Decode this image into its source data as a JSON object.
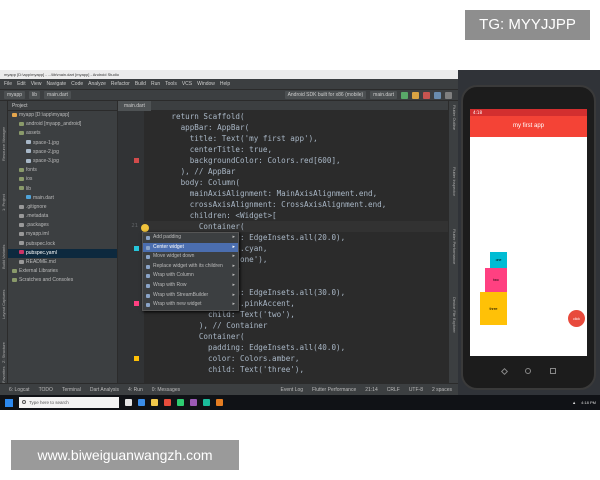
{
  "watermarks": {
    "top": "TG: MYYJJPP",
    "bottom": "www.biweiguanwangzh.com"
  },
  "ide": {
    "window_title": "myapp [D:\\app\\myapp] - ...\\lib\\main.dart [myapp] - Android Studio",
    "menu": [
      "File",
      "Edit",
      "View",
      "Navigate",
      "Code",
      "Analyze",
      "Refactor",
      "Build",
      "Run",
      "Tools",
      "VCS",
      "Window",
      "Help"
    ],
    "toolbar": {
      "project": "myapp",
      "folder": "lib",
      "file": "main.dart",
      "device": "Android SDK built for x86 (mobile)",
      "run_config": "main.dart"
    },
    "project_panel": {
      "header": "Project",
      "tree": [
        {
          "label": "myapp [D:\\app\\myapp]",
          "indent": 0,
          "color": "#e5a64d"
        },
        {
          "label": "android [myapp_android]",
          "indent": 1,
          "color": "#8a9a6a"
        },
        {
          "label": "assets",
          "indent": 1,
          "color": "#8a9a6a"
        },
        {
          "label": "space-1.jpg",
          "indent": 2,
          "color": "#a8b8c8"
        },
        {
          "label": "space-2.jpg",
          "indent": 2,
          "color": "#a8b8c8"
        },
        {
          "label": "space-3.jpg",
          "indent": 2,
          "color": "#a8b8c8"
        },
        {
          "label": "fonts",
          "indent": 1,
          "color": "#8a9a6a"
        },
        {
          "label": "ios",
          "indent": 1,
          "color": "#8a9a6a"
        },
        {
          "label": "lib",
          "indent": 1,
          "color": "#8a9a6a"
        },
        {
          "label": "main.dart",
          "indent": 2,
          "color": "#4fa3d8"
        },
        {
          "label": ".gitignore",
          "indent": 1,
          "color": "#999999"
        },
        {
          "label": ".metadata",
          "indent": 1,
          "color": "#999999"
        },
        {
          "label": ".packages",
          "indent": 1,
          "color": "#999999"
        },
        {
          "label": "myapp.iml",
          "indent": 1,
          "color": "#999999"
        },
        {
          "label": "pubspec.lock",
          "indent": 1,
          "color": "#999999"
        },
        {
          "label": "pubspec.yaml",
          "indent": 1,
          "color": "#c36",
          "selected": true
        },
        {
          "label": "README.md",
          "indent": 1,
          "color": "#999999"
        },
        {
          "label": "External Libraries",
          "indent": 0,
          "color": "#8a9a6a"
        },
        {
          "label": "Scratches and Consoles",
          "indent": 0,
          "color": "#8a9a6a"
        }
      ]
    },
    "left_tools": [
      "Resource Manager",
      "1: Project",
      "Build Variants",
      "Layout Captures",
      "Z: Structure",
      "Favorites"
    ],
    "right_tools": [
      "Flutter Outline",
      "Flutter Inspector",
      "Flutter Performance",
      "Device File Explorer"
    ],
    "editor": {
      "tab": "main.dart",
      "lines": [
        {
          "num": "",
          "text": "      return Scaffold("
        },
        {
          "num": "",
          "text": "        appBar: AppBar("
        },
        {
          "num": "",
          "text": "          title: Text('my first app'),"
        },
        {
          "num": "",
          "text": "          centerTitle: true,"
        },
        {
          "num": "",
          "text": "          backgroundColor: Colors.red[600],",
          "mark": "#d24b4b"
        },
        {
          "num": "",
          "text": "        ), // AppBar"
        },
        {
          "num": "",
          "text": "        body: Column("
        },
        {
          "num": "",
          "text": "          mainAxisAlignment: MainAxisAlignment.end,"
        },
        {
          "num": "",
          "text": "          crossAxisAlignment: CrossAxisAlignment.end,"
        },
        {
          "num": "",
          "text": "          children: <Widget>["
        },
        {
          "num": "21",
          "text": "            Container(",
          "hl": true
        },
        {
          "num": "",
          "text": "              padding: EdgeInsets.all(20.0),"
        },
        {
          "num": "",
          "text": "                   rs.cyan,",
          "mark": "#26c6da"
        },
        {
          "num": "",
          "text": "                   ('one'),"
        },
        {
          "num": "",
          "text": "                   er"
        },
        {
          "num": "",
          "text": ""
        },
        {
          "num": "",
          "text": "              padding: EdgeInsets.all(30.0),"
        },
        {
          "num": "",
          "text": "                   rs.pinkAccent,",
          "mark": "#ff4081"
        },
        {
          "num": "",
          "text": "              child: Text('two'),"
        },
        {
          "num": "",
          "text": "            ), // Container"
        },
        {
          "num": "",
          "text": "            Container("
        },
        {
          "num": "",
          "text": "              padding: EdgeInsets.all(40.0),"
        },
        {
          "num": "",
          "text": "              color: Colors.amber,",
          "mark": "#ffc107"
        },
        {
          "num": "",
          "text": "              child: Text('three'),"
        }
      ]
    },
    "context_menu": [
      {
        "label": "Add padding"
      },
      {
        "label": "Center widget",
        "selected": true
      },
      {
        "label": "Move widget down"
      },
      {
        "label": "Replace widget with its children"
      },
      {
        "label": "Wrap with Column"
      },
      {
        "label": "Wrap with Row"
      },
      {
        "label": "Wrap with StreamBuilder"
      },
      {
        "label": "Wrap with new widget"
      }
    ],
    "bottom_tools": [
      "6: Logcat",
      "TODO",
      "Terminal",
      "Dart Analysis",
      "4: Run",
      "0: Messages"
    ],
    "bottom_right": [
      "Event Log",
      "Flutter Performance"
    ],
    "status": {
      "position": "21:14",
      "line_sep": "CRLF",
      "encoding": "UTF-8",
      "indent": "2 spaces"
    }
  },
  "phone": {
    "status_time": "4:18",
    "app_title": "my first app",
    "boxes": [
      {
        "label": "one",
        "color": "#00bcd4"
      },
      {
        "label": "two",
        "color": "#ff4081"
      },
      {
        "label": "three",
        "color": "#ffc107"
      }
    ],
    "fab_label": "click"
  },
  "taskbar": {
    "search_placeholder": "Type here to search",
    "time": "4:18 PM"
  }
}
